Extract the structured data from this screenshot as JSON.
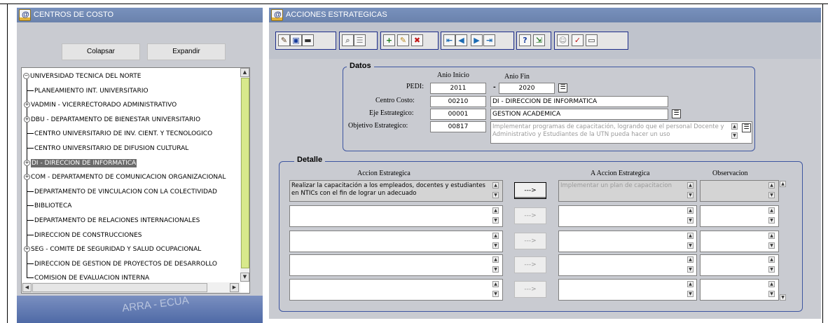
{
  "left_window": {
    "title": "CENTROS DE COSTO",
    "collapse_label": "Colapsar",
    "expand_label": "Expandir",
    "watermark": "ARRA - ECUA",
    "tree": [
      {
        "label": "UNIVERSIDAD TECNICA DEL NORTE",
        "expander": "−",
        "root": true
      },
      {
        "label": "PLANEAMIENTO INT. UNIVERSITARIO",
        "expander": ""
      },
      {
        "label": "VADMIN - VICERRECTORADO ADMINISTRATIVO",
        "expander": "+"
      },
      {
        "label": "DBU - DEPARTAMENTO DE BIENESTAR UNIVERSITARIO",
        "expander": "+"
      },
      {
        "label": "CENTRO UNIVERSITARIO DE INV. CIENT. Y TECNOLOGICO",
        "expander": ""
      },
      {
        "label": "CENTRO UNIVERSITARIO DE DIFUSION CULTURAL",
        "expander": ""
      },
      {
        "label": "DI - DIRECCION DE INFORMATICA",
        "expander": "+",
        "selected": true
      },
      {
        "label": "COM - DEPARTAMENTO DE COMUNICACION ORGANIZACIONAL",
        "expander": "+"
      },
      {
        "label": "DEPARTAMENTO DE VINCULACION CON LA COLECTIVIDAD",
        "expander": ""
      },
      {
        "label": "BIBLIOTECA",
        "expander": ""
      },
      {
        "label": "DEPARTAMENTO DE RELACIONES INTERNACIONALES",
        "expander": ""
      },
      {
        "label": "DIRECCION DE CONSTRUCCIONES",
        "expander": ""
      },
      {
        "label": "SEG - COMITE DE SEGURIDAD Y SALUD OCUPACIONAL",
        "expander": "+"
      },
      {
        "label": "DIRECCION DE GESTION DE PROYECTOS DE DESARROLLO",
        "expander": ""
      },
      {
        "label": "COMISION DE EVALUACION INTERNA",
        "expander": ""
      }
    ]
  },
  "right_window": {
    "title": "ACCIONES ESTRATEGICAS",
    "toolbar": {
      "icons": [
        "pencil-icon",
        "save-icon",
        "print-icon",
        "find-icon",
        "list-icon",
        "insert-record-icon",
        "edit-record-icon",
        "delete-record-icon",
        "first-record-icon",
        "previous-record-icon",
        "next-record-icon",
        "last-record-icon",
        "help-icon",
        "exit-icon",
        "user-icon",
        "check-icon",
        "calendar-icon"
      ]
    },
    "datos": {
      "legend": "Datos",
      "anio_inicio_label": "Anio Inicio",
      "anio_fin_label": "Anio Fin",
      "pedi_label": "PEDI:",
      "pedi_inicio": "2011",
      "dash": "-",
      "pedi_fin": "2020",
      "centro_costo_label": "Centro Costo:",
      "centro_costo_code": "00210",
      "centro_costo_name": "DI - DIRECCION DE INFORMATICA",
      "eje_label": "Eje Estrategico:",
      "eje_code": "00001",
      "eje_name": "GESTION ACADEMICA",
      "objetivo_label": "Objetivo Estrategico:",
      "objetivo_code": "00817",
      "objetivo_text": "Implementar programas de capacitación, logrando que el personal Docente y Administrativo y Estudiantes de la UTN pueda hacer un uso"
    },
    "detalle": {
      "legend": "Detalle",
      "col_accion": "Accion Estrategica",
      "col_a_accion": "A Accion Estrategica",
      "col_observacion": "Observacion",
      "arrow_label": "--->",
      "rows": [
        {
          "accion": "Realizar  la capacitación  a los empleados, docentes y estudiantes en NTICs  con el fin de lograr un adecuado",
          "a_accion": "Implementar un plan de capacitacion",
          "observacion": ""
        },
        {
          "accion": "",
          "a_accion": "",
          "observacion": ""
        },
        {
          "accion": "",
          "a_accion": "",
          "observacion": ""
        },
        {
          "accion": "",
          "a_accion": "",
          "observacion": ""
        },
        {
          "accion": "",
          "a_accion": "",
          "observacion": ""
        }
      ]
    }
  }
}
